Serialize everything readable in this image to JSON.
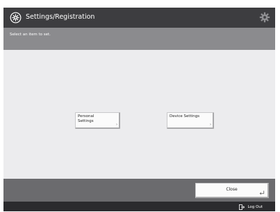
{
  "title_bar": {
    "title": "Settings/Registration",
    "left_icon": "settings-registration-icon",
    "right_icon": "gear-icon"
  },
  "subheader": {
    "instruction": "Select an item to set."
  },
  "menu": {
    "items": [
      {
        "label": "Personal\nSettings",
        "arrow": "›"
      },
      {
        "label": "Device Settings",
        "arrow": "›"
      }
    ]
  },
  "footer": {
    "close_label": "Close",
    "close_icon": "return-arrow-icon"
  },
  "status_bar": {
    "logout_label": "Log Out",
    "logout_icon": "logout-icon"
  },
  "colors": {
    "title_bar": "#3d3d40",
    "subheader": "#8b8b8e",
    "content": "#ececee",
    "footer": "#6b6b6e",
    "status_bar": "#2b2b2e"
  }
}
